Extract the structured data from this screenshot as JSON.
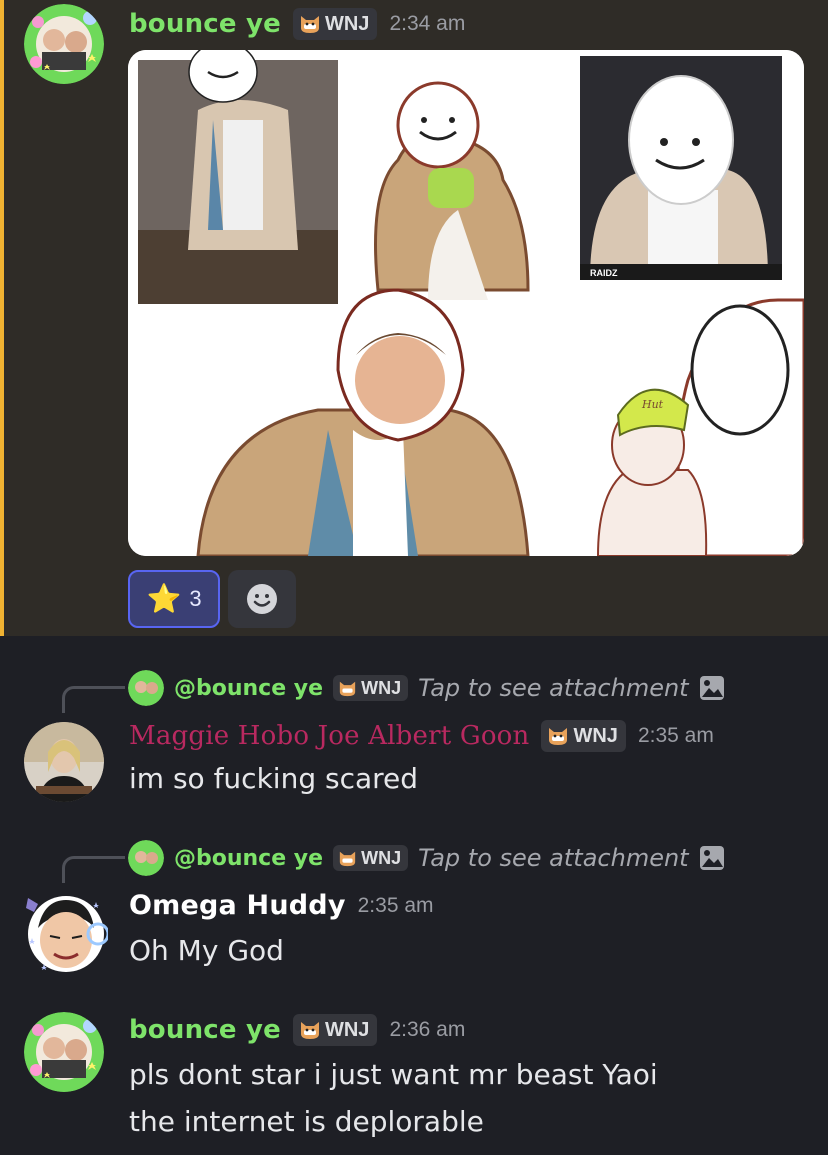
{
  "messages": [
    {
      "author": "bounce ye",
      "tag": "WNJ",
      "time": "2:34 am",
      "reactions": {
        "star_emoji": "⭐",
        "star_count": "3"
      }
    },
    {
      "reply_to": {
        "author": "@bounce ye",
        "tag": "WNJ",
        "preview": "Tap to see attachment"
      },
      "author": "Maggie Hobo Joe Albert Goon",
      "tag": "WNJ",
      "time": "2:35 am",
      "text": "im so fucking scared"
    },
    {
      "reply_to": {
        "author": "@bounce ye",
        "tag": "WNJ",
        "preview": "Tap to see attachment"
      },
      "author": "Omega Huddy",
      "time": "2:35 am",
      "text": "Oh My God"
    },
    {
      "author": "bounce ye",
      "tag": "WNJ",
      "time": "2:36 am",
      "lines": [
        "pls dont star i just want mr beast Yaoi",
        "the internet is deplorable"
      ]
    }
  ],
  "image_caption_text": {
    "left_badge": "RAIDZ",
    "hat_text": "Hut"
  },
  "colors": {
    "background": "#1e1f25",
    "highlight_background": "#2f2c27",
    "highlight_bar": "#f0b232",
    "bounce_name": "#7ee36a",
    "maggie_name": "#b92960",
    "reaction_bg": "#3a3f74",
    "reaction_border": "#5865f2"
  },
  "icons": [
    "cat-badge-icon",
    "add-reaction-icon",
    "image-attachment-icon",
    "star-emoji-icon"
  ]
}
